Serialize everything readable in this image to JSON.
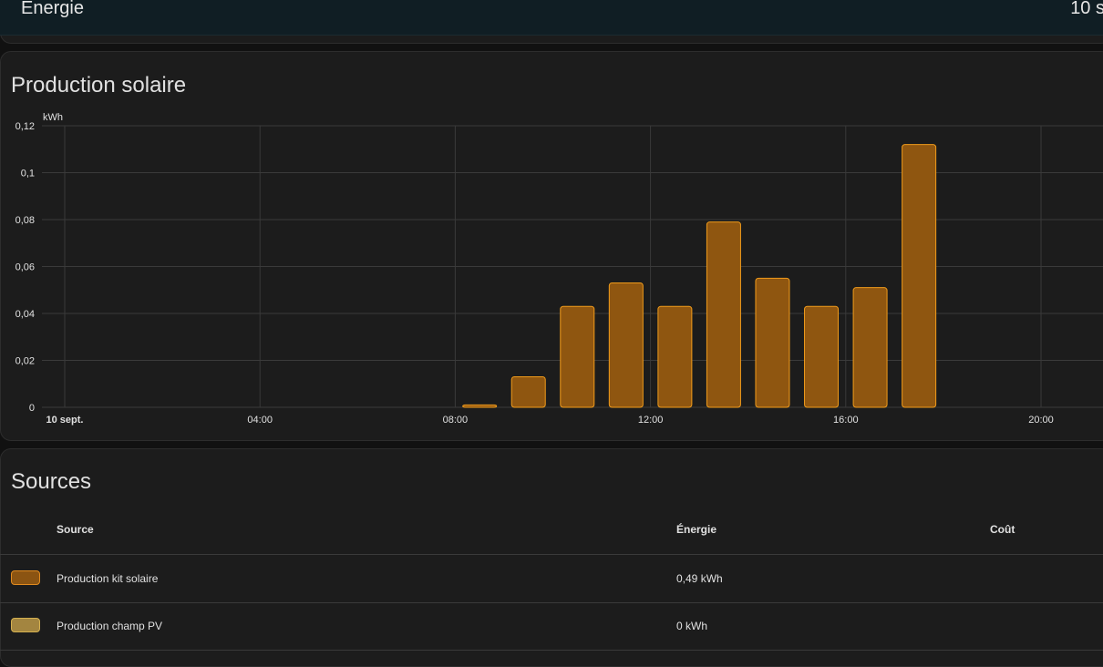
{
  "header": {
    "title": "Énergie",
    "date": "10 s"
  },
  "chart_card": {
    "title": "Production solaire"
  },
  "chart_data": {
    "type": "bar",
    "title": "Production solaire",
    "unit": "kWh",
    "ylabel": "kWh",
    "ylim": [
      0,
      0.12
    ],
    "y_ticks": [
      "0",
      "0,02",
      "0,04",
      "0,06",
      "0,08",
      "0,1",
      "0,12"
    ],
    "x_ticks": [
      "10 sept.",
      "04:00",
      "08:00",
      "12:00",
      "16:00",
      "20:00"
    ],
    "grid": true,
    "series": [
      {
        "name": "Production kit solaire",
        "color": "#a8620f",
        "points": [
          {
            "hour": 8,
            "value": 0.001
          },
          {
            "hour": 9,
            "value": 0.013
          },
          {
            "hour": 10,
            "value": 0.043
          },
          {
            "hour": 11,
            "value": 0.053
          },
          {
            "hour": 12,
            "value": 0.043
          },
          {
            "hour": 13,
            "value": 0.079
          },
          {
            "hour": 14,
            "value": 0.055
          },
          {
            "hour": 15,
            "value": 0.043
          },
          {
            "hour": 16,
            "value": 0.051
          },
          {
            "hour": 17,
            "value": 0.112
          }
        ]
      }
    ]
  },
  "sources_card": {
    "title": "Sources",
    "columns": {
      "source": "Source",
      "energy": "Énergie",
      "cost": "Coût"
    },
    "rows": [
      {
        "name": "Production kit solaire",
        "energy": "0,49 kWh",
        "swatch_color": "#8b5412",
        "swatch_border": "#e08a1f"
      },
      {
        "name": "Production champ PV",
        "energy": "0 kWh",
        "swatch_color": "#a38540",
        "swatch_border": "#d4b050"
      }
    ]
  },
  "colors": {
    "bar_fill": "#8f5610",
    "bar_stroke": "#f09b1b",
    "grid": "#3a3a3a",
    "background": "#1c1c1c"
  }
}
